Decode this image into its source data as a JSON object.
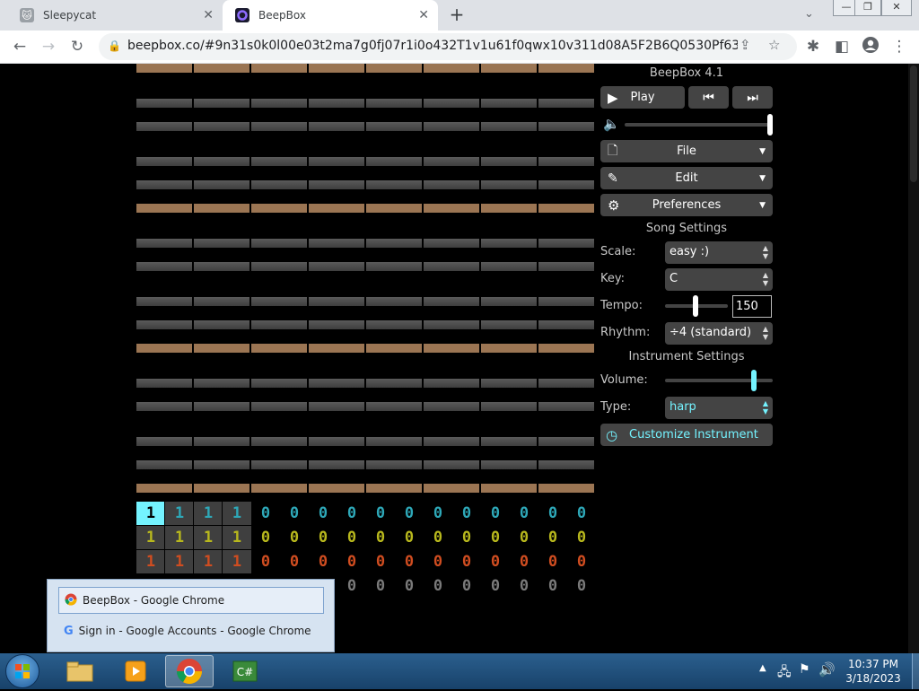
{
  "browser": {
    "tabs": [
      {
        "title": "Sleepycat",
        "active": false
      },
      {
        "title": "BeepBox",
        "active": true
      }
    ],
    "url": "beepbox.co/#9n31s0k0l00e03t2ma7g0fj07r1i0o432T1v1u61f0qwx10v311d08A5F2B6Q0530Pf636E2b677T5v..."
  },
  "app": {
    "title": "BeepBox 4.1",
    "play_label": "Play",
    "menus": {
      "file": "File",
      "edit": "Edit",
      "preferences": "Preferences"
    },
    "song_settings": {
      "heading": "Song Settings",
      "scale_label": "Scale:",
      "scale_value": "easy :)",
      "key_label": "Key:",
      "key_value": "C",
      "tempo_label": "Tempo:",
      "tempo_value": "150",
      "rhythm_label": "Rhythm:",
      "rhythm_value": "÷4 (standard)"
    },
    "instrument_settings": {
      "heading": "Instrument Settings",
      "volume_label": "Volume:",
      "type_label": "Type:",
      "type_value": "harp",
      "customize_label": "Customize Instrument"
    },
    "colors": {
      "accent": "#7aeaff",
      "harp": "#74f3ff",
      "tan_bar": "#9b7553"
    },
    "volume_fraction": 0.84,
    "master_volume_fraction": 1.0,
    "tempo_fraction": 0.48
  },
  "pattern_grid": {
    "rows": [
      {
        "values": [
          "1",
          "1",
          "1",
          "1",
          "0",
          "0",
          "0",
          "0",
          "0",
          "0",
          "0",
          "0",
          "0",
          "0",
          "0",
          "0"
        ],
        "color": "#2ea8b8",
        "selected_color": "#74f3ff"
      },
      {
        "values": [
          "1",
          "1",
          "1",
          "1",
          "0",
          "0",
          "0",
          "0",
          "0",
          "0",
          "0",
          "0",
          "0",
          "0",
          "0",
          "0"
        ],
        "color": "#b8b81d"
      },
      {
        "values": [
          "1",
          "1",
          "1",
          "1",
          "0",
          "0",
          "0",
          "0",
          "0",
          "0",
          "0",
          "0",
          "0",
          "0",
          "0",
          "0"
        ],
        "color": "#d04d20"
      },
      {
        "values": [
          "",
          "",
          "",
          "",
          "0",
          "0",
          "0",
          "0",
          "0",
          "0",
          "0",
          "0",
          "0",
          "0",
          "0",
          "0"
        ],
        "color": "#7a7a7a"
      }
    ]
  },
  "popup": {
    "items": [
      "BeepBox - Google Chrome",
      "Sign in - Google Accounts - Google Chrome"
    ]
  },
  "taskbar": {
    "time": "10:37 PM",
    "date": "3/18/2023"
  }
}
